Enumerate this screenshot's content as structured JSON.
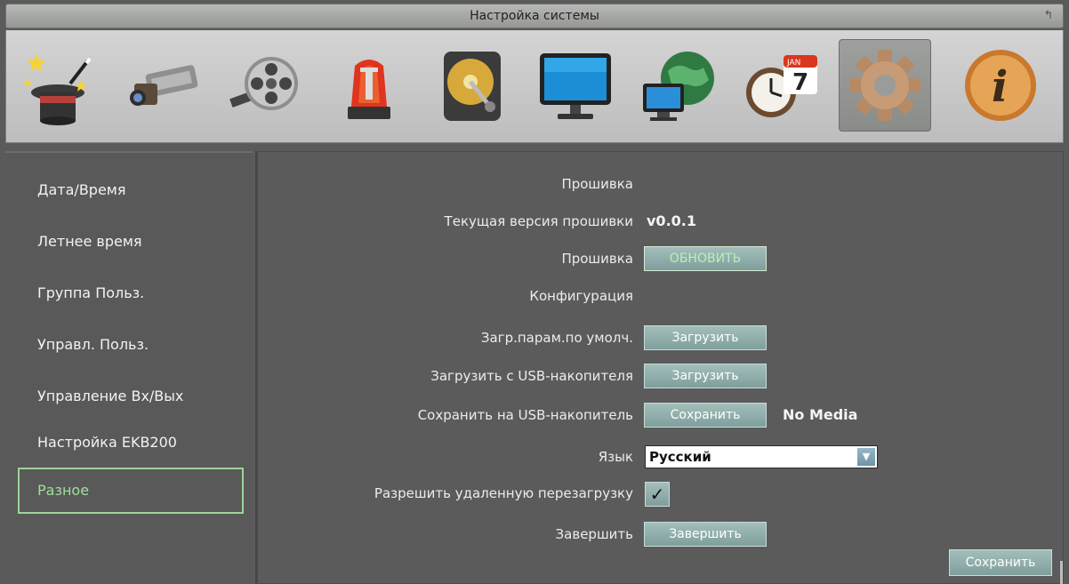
{
  "window": {
    "title": "Настройка системы"
  },
  "toolbar": {
    "items": [
      {
        "icon": "wizard-hat-icon"
      },
      {
        "icon": "camera-icon"
      },
      {
        "icon": "film-reel-icon"
      },
      {
        "icon": "alarm-siren-icon"
      },
      {
        "icon": "hard-drive-icon"
      },
      {
        "icon": "monitor-icon"
      },
      {
        "icon": "network-globe-icon"
      },
      {
        "icon": "schedule-clock-icon",
        "calendar_day": "7",
        "calendar_month": "JAN"
      },
      {
        "icon": "gear-icon",
        "active": true
      },
      {
        "icon": "info-icon",
        "glyph": "i"
      }
    ]
  },
  "sidebar": {
    "items": [
      {
        "label": "Дата/Время"
      },
      {
        "label": "Летнее время"
      },
      {
        "label": "Группа Польз."
      },
      {
        "label": "Управл. Польз."
      },
      {
        "label": "Управление Вх/Вых"
      },
      {
        "label": "Настройка EKB200"
      },
      {
        "label": "Разное",
        "active": true
      }
    ]
  },
  "main": {
    "firmware_header": "Прошивка",
    "current_version_label": "Текущая версия прошивки",
    "current_version_value": "v0.0.1",
    "firmware_label": "Прошивка",
    "update_button": "ОБНОВИТЬ",
    "config_header": "Конфигурация",
    "load_defaults_label": "Загр.парам.по умолч.",
    "load_defaults_button": "Загрузить",
    "load_usb_label": "Загрузить с USB-накопителя",
    "load_usb_button": "Загрузить",
    "save_usb_label": "Сохранить на USB-накопитель",
    "save_usb_button": "Сохранить",
    "save_usb_status": "No Media",
    "language_label": "Язык",
    "language_value": "Русский",
    "remote_reboot_label": "Разрешить удаленную перезагрузку",
    "remote_reboot_checked": true,
    "finish_label": "Завершить",
    "finish_button": "Завершить",
    "save_button": "Сохранить"
  },
  "colors": {
    "accent_green": "#9fe09a",
    "button_teal": "#8fb0ad",
    "panel_bg": "#5b5b5b"
  }
}
